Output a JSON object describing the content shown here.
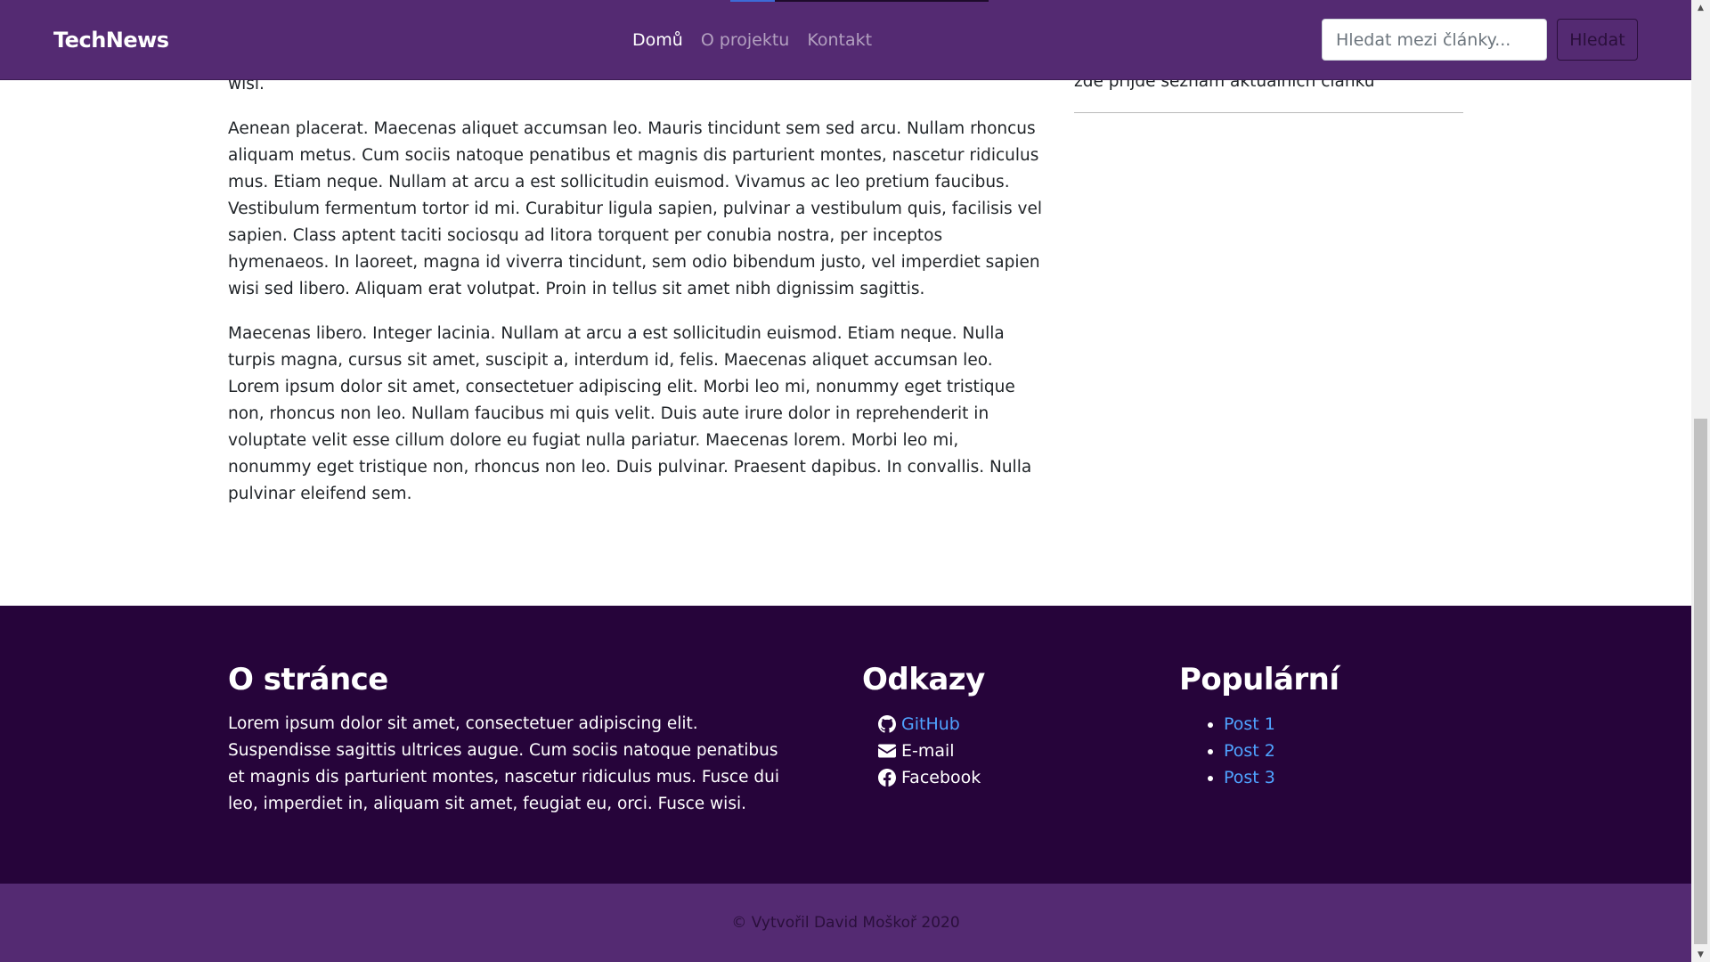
{
  "navbar": {
    "brand": "TechNews",
    "links": [
      {
        "label": "Domů",
        "active": true
      },
      {
        "label": "O projektu",
        "active": false
      },
      {
        "label": "Kontakt",
        "active": false
      }
    ],
    "search_placeholder": "Hledat mezi články...",
    "search_button": "Hledat"
  },
  "article": {
    "paragraphs": [
      "wisi.",
      "Aenean placerat. Maecenas aliquet accumsan leo. Mauris tincidunt sem sed arcu. Nullam rhoncus aliquam metus. Cum sociis natoque penatibus et magnis dis parturient montes, nascetur ridiculus mus. Etiam neque. Nullam at arcu a est sollicitudin euismod. Vivamus ac leo pretium faucibus. Vestibulum fermentum tortor id mi. Curabitur ligula sapien, pulvinar a vestibulum quis, facilisis vel sapien. Class aptent taciti sociosqu ad litora torquent per conubia nostra, per inceptos hymenaeos. In laoreet, magna id viverra tincidunt, sem odio bibendum justo, vel imperdiet sapien wisi sed libero. Aliquam erat volutpat. Proin in tellus sit amet nibh dignissim sagittis.",
      "Maecenas libero. Integer lacinia. Nullam at arcu a est sollicitudin euismod. Etiam neque. Nulla turpis magna, cursus sit amet, suscipit a, interdum id, felis. Maecenas aliquet accumsan leo. Lorem ipsum dolor sit amet, consectetuer adipiscing elit. Morbi leo mi, nonummy eget tristique non, rhoncus non leo. Nullam faucibus mi quis velit. Duis aute irure dolor in reprehenderit in voluptate velit esse cillum dolore eu fugiat nulla pariatur. Maecenas lorem. Morbi leo mi, nonummy eget tristique non, rhoncus non leo. Duis pulvinar. Praesent dapibus. In convallis. Nulla pulvinar eleifend sem."
    ]
  },
  "sidebar": {
    "text": "zde přijde seznam aktuálních článků"
  },
  "footer": {
    "about": {
      "title": "O stránce",
      "text": "Lorem ipsum dolor sit amet, consectetuer adipiscing elit. Suspendisse sagittis ultrices augue. Cum sociis natoque penatibus et magnis dis parturient montes, nascetur ridiculus mus. Fusce dui leo, imperdiet in, aliquam sit amet, feugiat eu, orci. Fusce wisi."
    },
    "links": {
      "title": "Odkazy",
      "items": [
        {
          "label": "GitHub",
          "icon": "github-icon"
        },
        {
          "label": "E-mail",
          "icon": "envelope-icon"
        },
        {
          "label": "Facebook",
          "icon": "facebook-icon"
        }
      ]
    },
    "popular": {
      "title": "Populární",
      "items": [
        "Post 1",
        "Post 2",
        "Post 3"
      ]
    },
    "copyright": "© Vytvořil David Moškoř 2020"
  },
  "colors": {
    "navbar_bg": "#542a72",
    "footer_bg": "#26043a",
    "link_blue": "#4fa3ff"
  }
}
